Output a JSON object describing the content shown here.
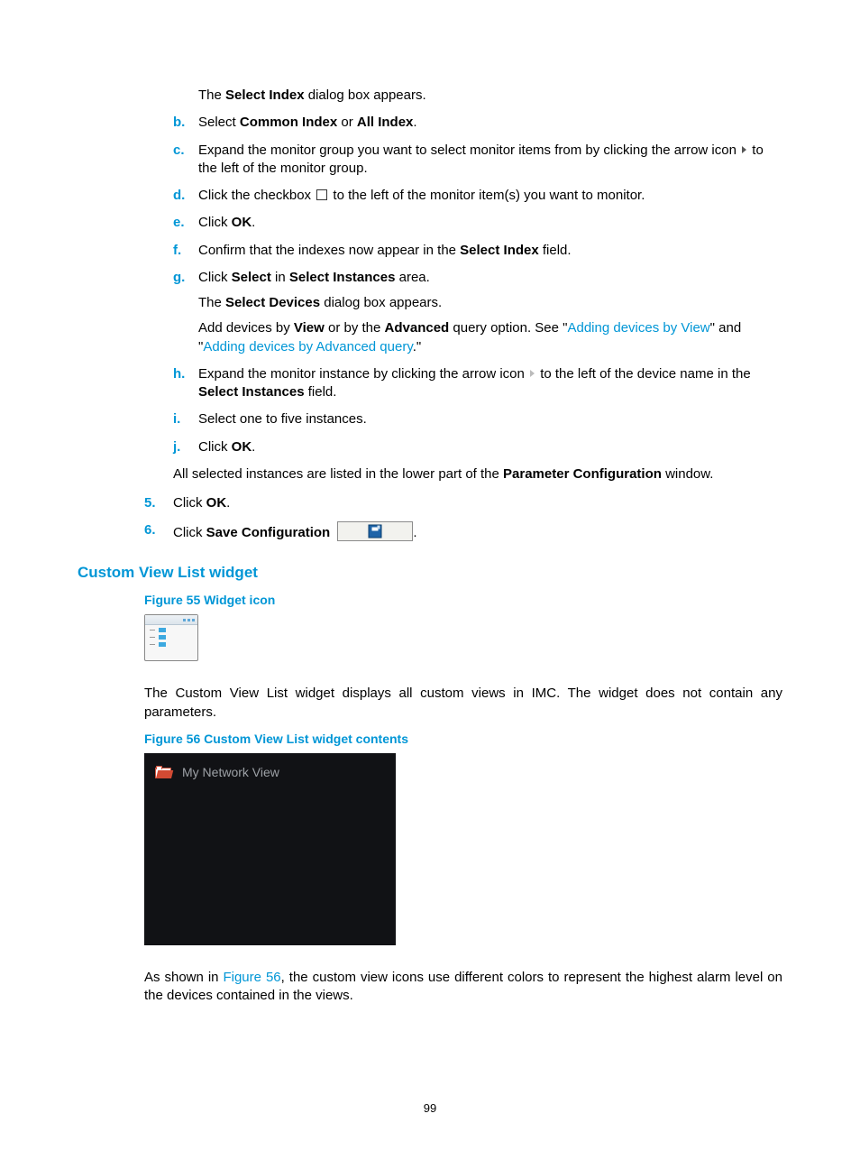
{
  "letters": {
    "a_followup": "The <b>Select Index</b> dialog box appears.",
    "b": "Select <b>Common Index</b> or <b>All Index</b>.",
    "c": "Expand the monitor group you want to select monitor items from by clicking the arrow icon",
    "c_tail": "to the left of the monitor group.",
    "d_pre": "Click the checkbox",
    "d_post": "to the left of the monitor item(s) you want to monitor.",
    "e": "Click <b>OK</b>.",
    "f": "Confirm that the indexes now appear in the <b>Select Index</b> field.",
    "g": "Click <b>Select</b> in <b>Select Instances</b> area.",
    "g2": "The <b>Select Devices</b> dialog box appears.",
    "g3_pre": "Add devices by <b>View</b> or by the <b>Advanced</b> query option. See \"",
    "g3_link1": "Adding devices by View",
    "g3_mid": "\" and \"",
    "g3_link2": "Adding devices by Advanced query",
    "g3_post": ".\"",
    "h_pre": "Expand the monitor instance by clicking the arrow icon",
    "h_post": "to the left of the device name in the <b>Select Instances</b> field.",
    "i": "Select one to five instances.",
    "j": "Click <b>OK</b>."
  },
  "after_letters": "All selected instances are listed in the lower part of the <b>Parameter Configuration</b> window.",
  "nums": {
    "n5": "Click <b>OK</b>.",
    "n6": "Click <b>Save Configuration</b>"
  },
  "h3": "Custom View List widget",
  "fig55": "Figure 55 Widget icon",
  "para1": "The Custom View List widget displays all custom views in IMC. The widget does not contain any parameters.",
  "fig56": "Figure 56 Custom View List widget contents",
  "fig56_item": "My Network View",
  "para2_pre": "As shown in ",
  "para2_link": "Figure 56",
  "para2_post": ", the custom view icons use different colors to represent the highest alarm level on the devices contained in the views.",
  "page_num": "99"
}
